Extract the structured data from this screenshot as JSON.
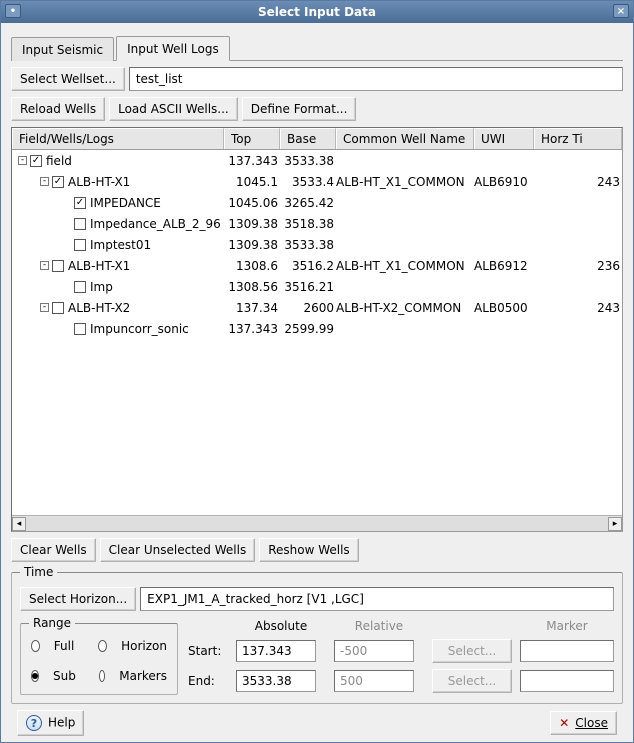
{
  "window": {
    "title": "Select Input Data"
  },
  "tabs": [
    {
      "label": "Input Seismic",
      "active": false
    },
    {
      "label": "Input Well Logs",
      "active": true
    }
  ],
  "wellset": {
    "button": "Select Wellset...",
    "value": "test_list"
  },
  "toolbar": {
    "reload": "Reload Wells",
    "load_ascii": "Load ASCII Wells...",
    "define_format": "Define Format..."
  },
  "columns": [
    "Field/Wells/Logs",
    "Top",
    "Base",
    "Common Well Name",
    "UWI",
    "Horz Ti"
  ],
  "tree": [
    {
      "indent": 0,
      "expand": "-",
      "check": true,
      "label": "field",
      "top": "137.343",
      "base": "3533.38",
      "common": "",
      "uwi": "",
      "horz": ""
    },
    {
      "indent": 1,
      "expand": "-",
      "check": true,
      "label": "ALB-HT-X1",
      "top": "1045.1",
      "base": "3533.4",
      "common": "ALB-HT_X1_COMMON",
      "uwi": "ALB6910",
      "horz": "243"
    },
    {
      "indent": 2,
      "expand": "",
      "check": true,
      "label": "IMPEDANCE",
      "top": "1045.06",
      "base": "3265.42",
      "common": "",
      "uwi": "",
      "horz": ""
    },
    {
      "indent": 2,
      "expand": "",
      "check": false,
      "label": "Impedance_ALB_2_96",
      "top": "1309.38",
      "base": "3518.38",
      "common": "",
      "uwi": "",
      "horz": ""
    },
    {
      "indent": 2,
      "expand": "",
      "check": false,
      "label": "Imptest01",
      "top": "1309.38",
      "base": "3533.38",
      "common": "",
      "uwi": "",
      "horz": ""
    },
    {
      "indent": 1,
      "expand": "-",
      "check": false,
      "label": "ALB-HT-X1",
      "top": "1308.6",
      "base": "3516.2",
      "common": "ALB-HT_X1_COMMON",
      "uwi": "ALB6912",
      "horz": "236"
    },
    {
      "indent": 2,
      "expand": "",
      "check": false,
      "label": "Imp",
      "top": "1308.56",
      "base": "3516.21",
      "common": "",
      "uwi": "",
      "horz": ""
    },
    {
      "indent": 1,
      "expand": "-",
      "check": false,
      "label": "ALB-HT-X2",
      "top": "137.34",
      "base": "2600",
      "common": "ALB-HT-X2_COMMON",
      "uwi": "ALB0500",
      "horz": "243"
    },
    {
      "indent": 2,
      "expand": "",
      "check": false,
      "label": "Impuncorr_sonic",
      "top": "137.343",
      "base": "2599.99",
      "common": "",
      "uwi": "",
      "horz": ""
    }
  ],
  "below_buttons": {
    "clear": "Clear Wells",
    "clear_unselected": "Clear Unselected Wells",
    "reshow": "Reshow Wells"
  },
  "time": {
    "legend": "Time",
    "select_horizon": "Select Horizon...",
    "horizon_value": "EXP1_JM1_A_tracked_horz [V1 ,LGC]",
    "range_legend": "Range",
    "range_options": {
      "full": "Full",
      "horizon": "Horizon",
      "sub": "Sub",
      "markers": "Markers",
      "selected": "sub"
    },
    "headers": {
      "absolute": "Absolute",
      "relative": "Relative",
      "marker": "Marker"
    },
    "start_label": "Start:",
    "end_label": "End:",
    "start_abs": "137.343",
    "end_abs": "3533.38",
    "start_rel": "-500",
    "end_rel": "500",
    "select_btn": "Select..."
  },
  "footer": {
    "help": "Help",
    "close": "Close"
  }
}
